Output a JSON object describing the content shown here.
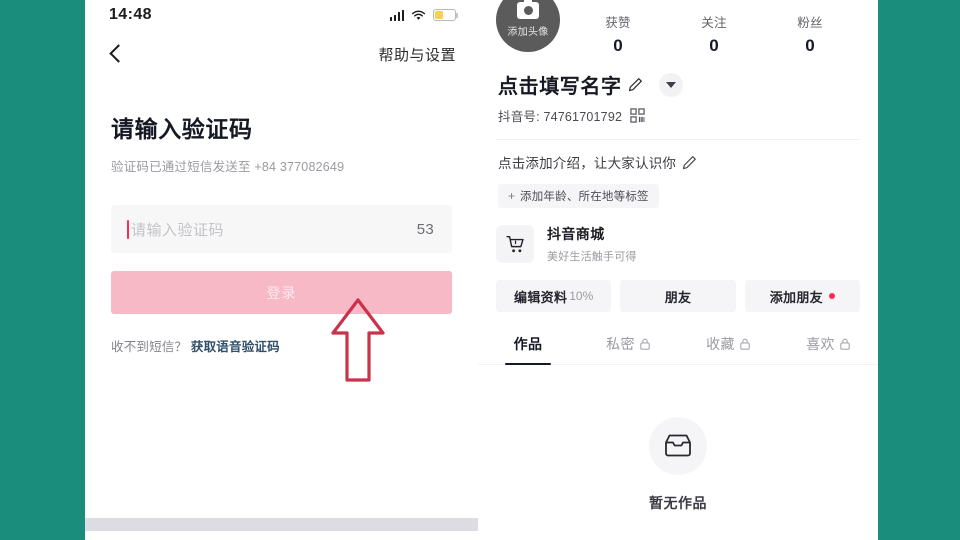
{
  "theme": {
    "background": "#1a8d7a",
    "panel_bg": "#ffffff",
    "accent_pink": "#f7b9c6",
    "accent_red": "#fe2c55",
    "annotation_red": "#c8324b"
  },
  "left_phone": {
    "status_bar": {
      "time": "14:48",
      "icons": [
        "signal-icon",
        "wifi-icon",
        "battery-icon"
      ]
    },
    "nav": {
      "back_icon": "back-chevron-icon",
      "help_settings": "帮助与设置"
    },
    "form": {
      "title": "请输入验证码",
      "subtitle": "验证码已通过短信发送至 +84 377082649",
      "code_input": {
        "value": "",
        "placeholder": "请输入验证码",
        "countdown": "53"
      },
      "login_button": "登录",
      "sms_question": "收不到短信？",
      "voice_code_link": "获取语音验证码"
    }
  },
  "annotation": {
    "type": "up-arrow",
    "color": "#c8324b",
    "points_at": "登录"
  },
  "right_profile": {
    "avatar": {
      "label": "添加头像",
      "icon": "camera-icon"
    },
    "stats": [
      {
        "label": "获赞",
        "value": "0"
      },
      {
        "label": "关注",
        "value": "0"
      },
      {
        "label": "粉丝",
        "value": "0"
      }
    ],
    "name": {
      "text": "点击填写名字",
      "edit_icon": "pencil-icon",
      "dropdown_icon": "chevron-down-icon"
    },
    "douyin_id": {
      "text": "抖音号: 74761701792",
      "qr_icon": "qr-code-icon"
    },
    "intro": {
      "text": "点击添加介绍，让大家认识你",
      "edit_icon": "pencil-icon"
    },
    "tag_chip": {
      "plus": "+",
      "label": "添加年龄、所在地等标签"
    },
    "mall": {
      "icon": "shopping-cart-icon",
      "title": "抖音商城",
      "subtitle": "美好生活触手可得"
    },
    "actions": [
      {
        "label": "编辑资料",
        "suffix": "10%",
        "badge": false
      },
      {
        "label": "朋友",
        "suffix": "",
        "badge": false
      },
      {
        "label": "添加朋友",
        "suffix": "",
        "badge": true
      }
    ],
    "tabs": [
      {
        "label": "作品",
        "locked": false,
        "active": true
      },
      {
        "label": "私密",
        "locked": true,
        "active": false
      },
      {
        "label": "收藏",
        "locked": true,
        "active": false
      },
      {
        "label": "喜欢",
        "locked": true,
        "active": false
      }
    ],
    "empty_state": {
      "icon": "inbox-icon",
      "text": "暂无作品"
    }
  }
}
